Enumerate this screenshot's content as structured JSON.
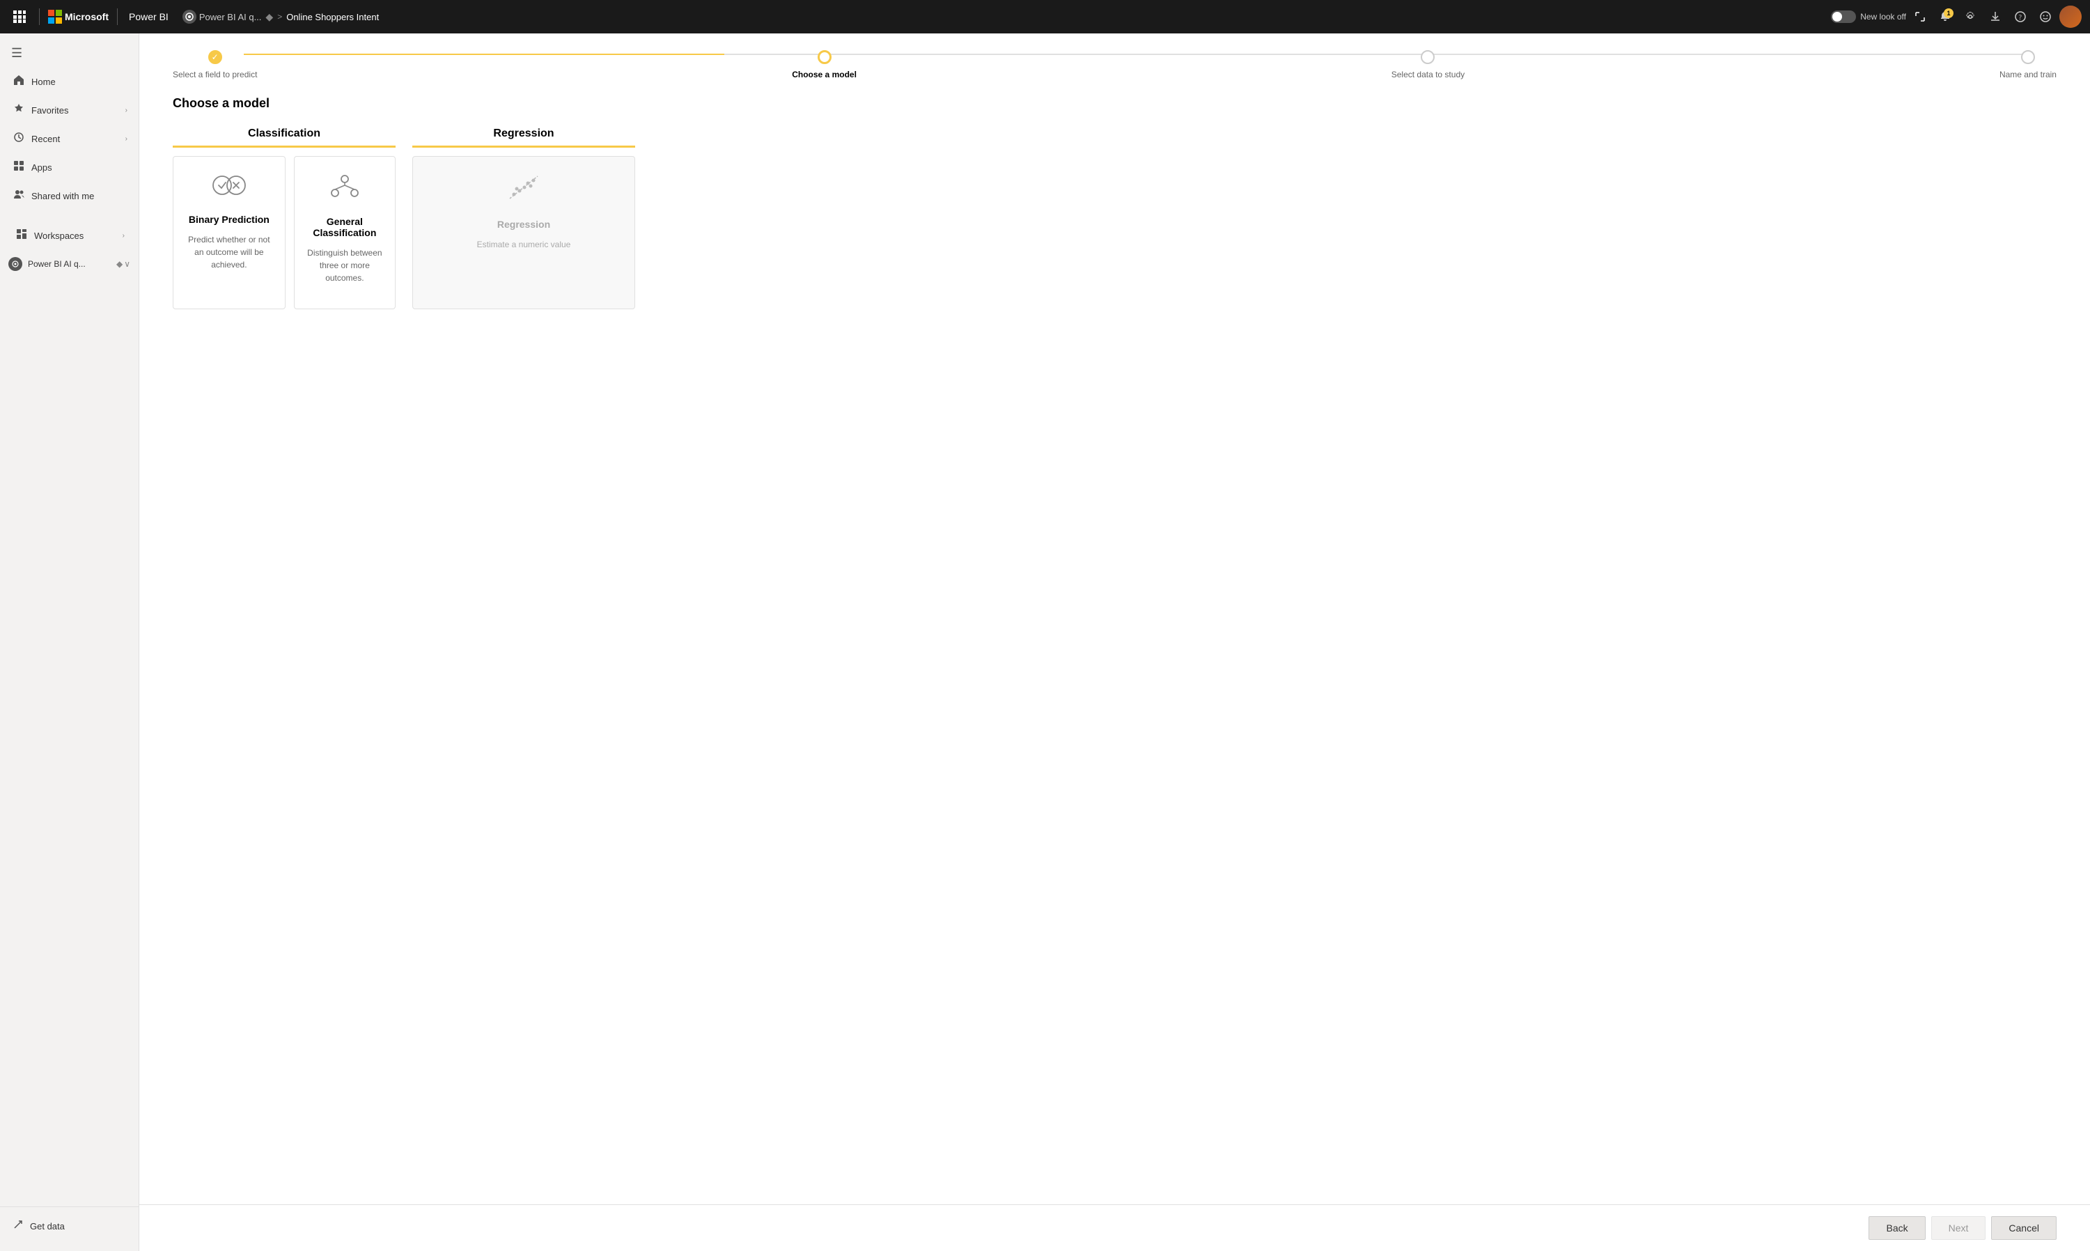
{
  "topnav": {
    "waffle_icon": "⊞",
    "microsoft_label": "Microsoft",
    "powerbi_label": "Power BI",
    "workspace_icon": "★",
    "workspace_name": "Power BI AI quickstart",
    "breadcrumb_divider": "◆",
    "breadcrumb_arrow": ">",
    "current_page": "Online Shoppers Intent",
    "toggle_label": "New look off",
    "notification_count": "1",
    "icons": {
      "expand": "⤢",
      "bell": "🔔",
      "settings": "⚙",
      "download": "⬇",
      "help": "?",
      "emoji": "🙂"
    }
  },
  "sidebar": {
    "collapse_icon": "☰",
    "items": [
      {
        "id": "home",
        "label": "Home",
        "icon": "⌂",
        "has_chevron": false
      },
      {
        "id": "favorites",
        "label": "Favorites",
        "icon": "★",
        "has_chevron": true
      },
      {
        "id": "recent",
        "label": "Recent",
        "icon": "🕐",
        "has_chevron": true
      },
      {
        "id": "apps",
        "label": "Apps",
        "icon": "⊞",
        "has_chevron": false
      },
      {
        "id": "shared",
        "label": "Shared with me",
        "icon": "👤",
        "has_chevron": false
      }
    ],
    "workspaces_label": "Workspaces",
    "workspaces_icon": "▦",
    "workspace_item": {
      "icon": "★",
      "label": "Power BI AI q...",
      "diamond_icon": "◆",
      "chevron_icon": "∨"
    },
    "bottom": {
      "get_data_label": "Get data",
      "get_data_icon": "↗"
    }
  },
  "wizard": {
    "steps": [
      {
        "id": "select-field",
        "label": "Select a field to predict",
        "state": "completed"
      },
      {
        "id": "choose-model",
        "label": "Choose a model",
        "state": "active"
      },
      {
        "id": "select-data",
        "label": "Select data to study",
        "state": "inactive"
      },
      {
        "id": "name-train",
        "label": "Name and train",
        "state": "inactive"
      }
    ]
  },
  "page": {
    "title": "Choose a model",
    "categories": [
      {
        "id": "classification",
        "label": "Classification",
        "models": [
          {
            "id": "binary-prediction",
            "title": "Binary Prediction",
            "description": "Predict whether or not an outcome will be achieved.",
            "disabled": false
          },
          {
            "id": "general-classification",
            "title": "General Classification",
            "description": "Distinguish between three or more outcomes.",
            "disabled": false
          }
        ]
      },
      {
        "id": "regression",
        "label": "Regression",
        "models": [
          {
            "id": "regression",
            "title": "Regression",
            "description": "Estimate a numeric value",
            "disabled": true
          }
        ]
      }
    ]
  },
  "footer": {
    "back_label": "Back",
    "next_label": "Next",
    "cancel_label": "Cancel"
  }
}
